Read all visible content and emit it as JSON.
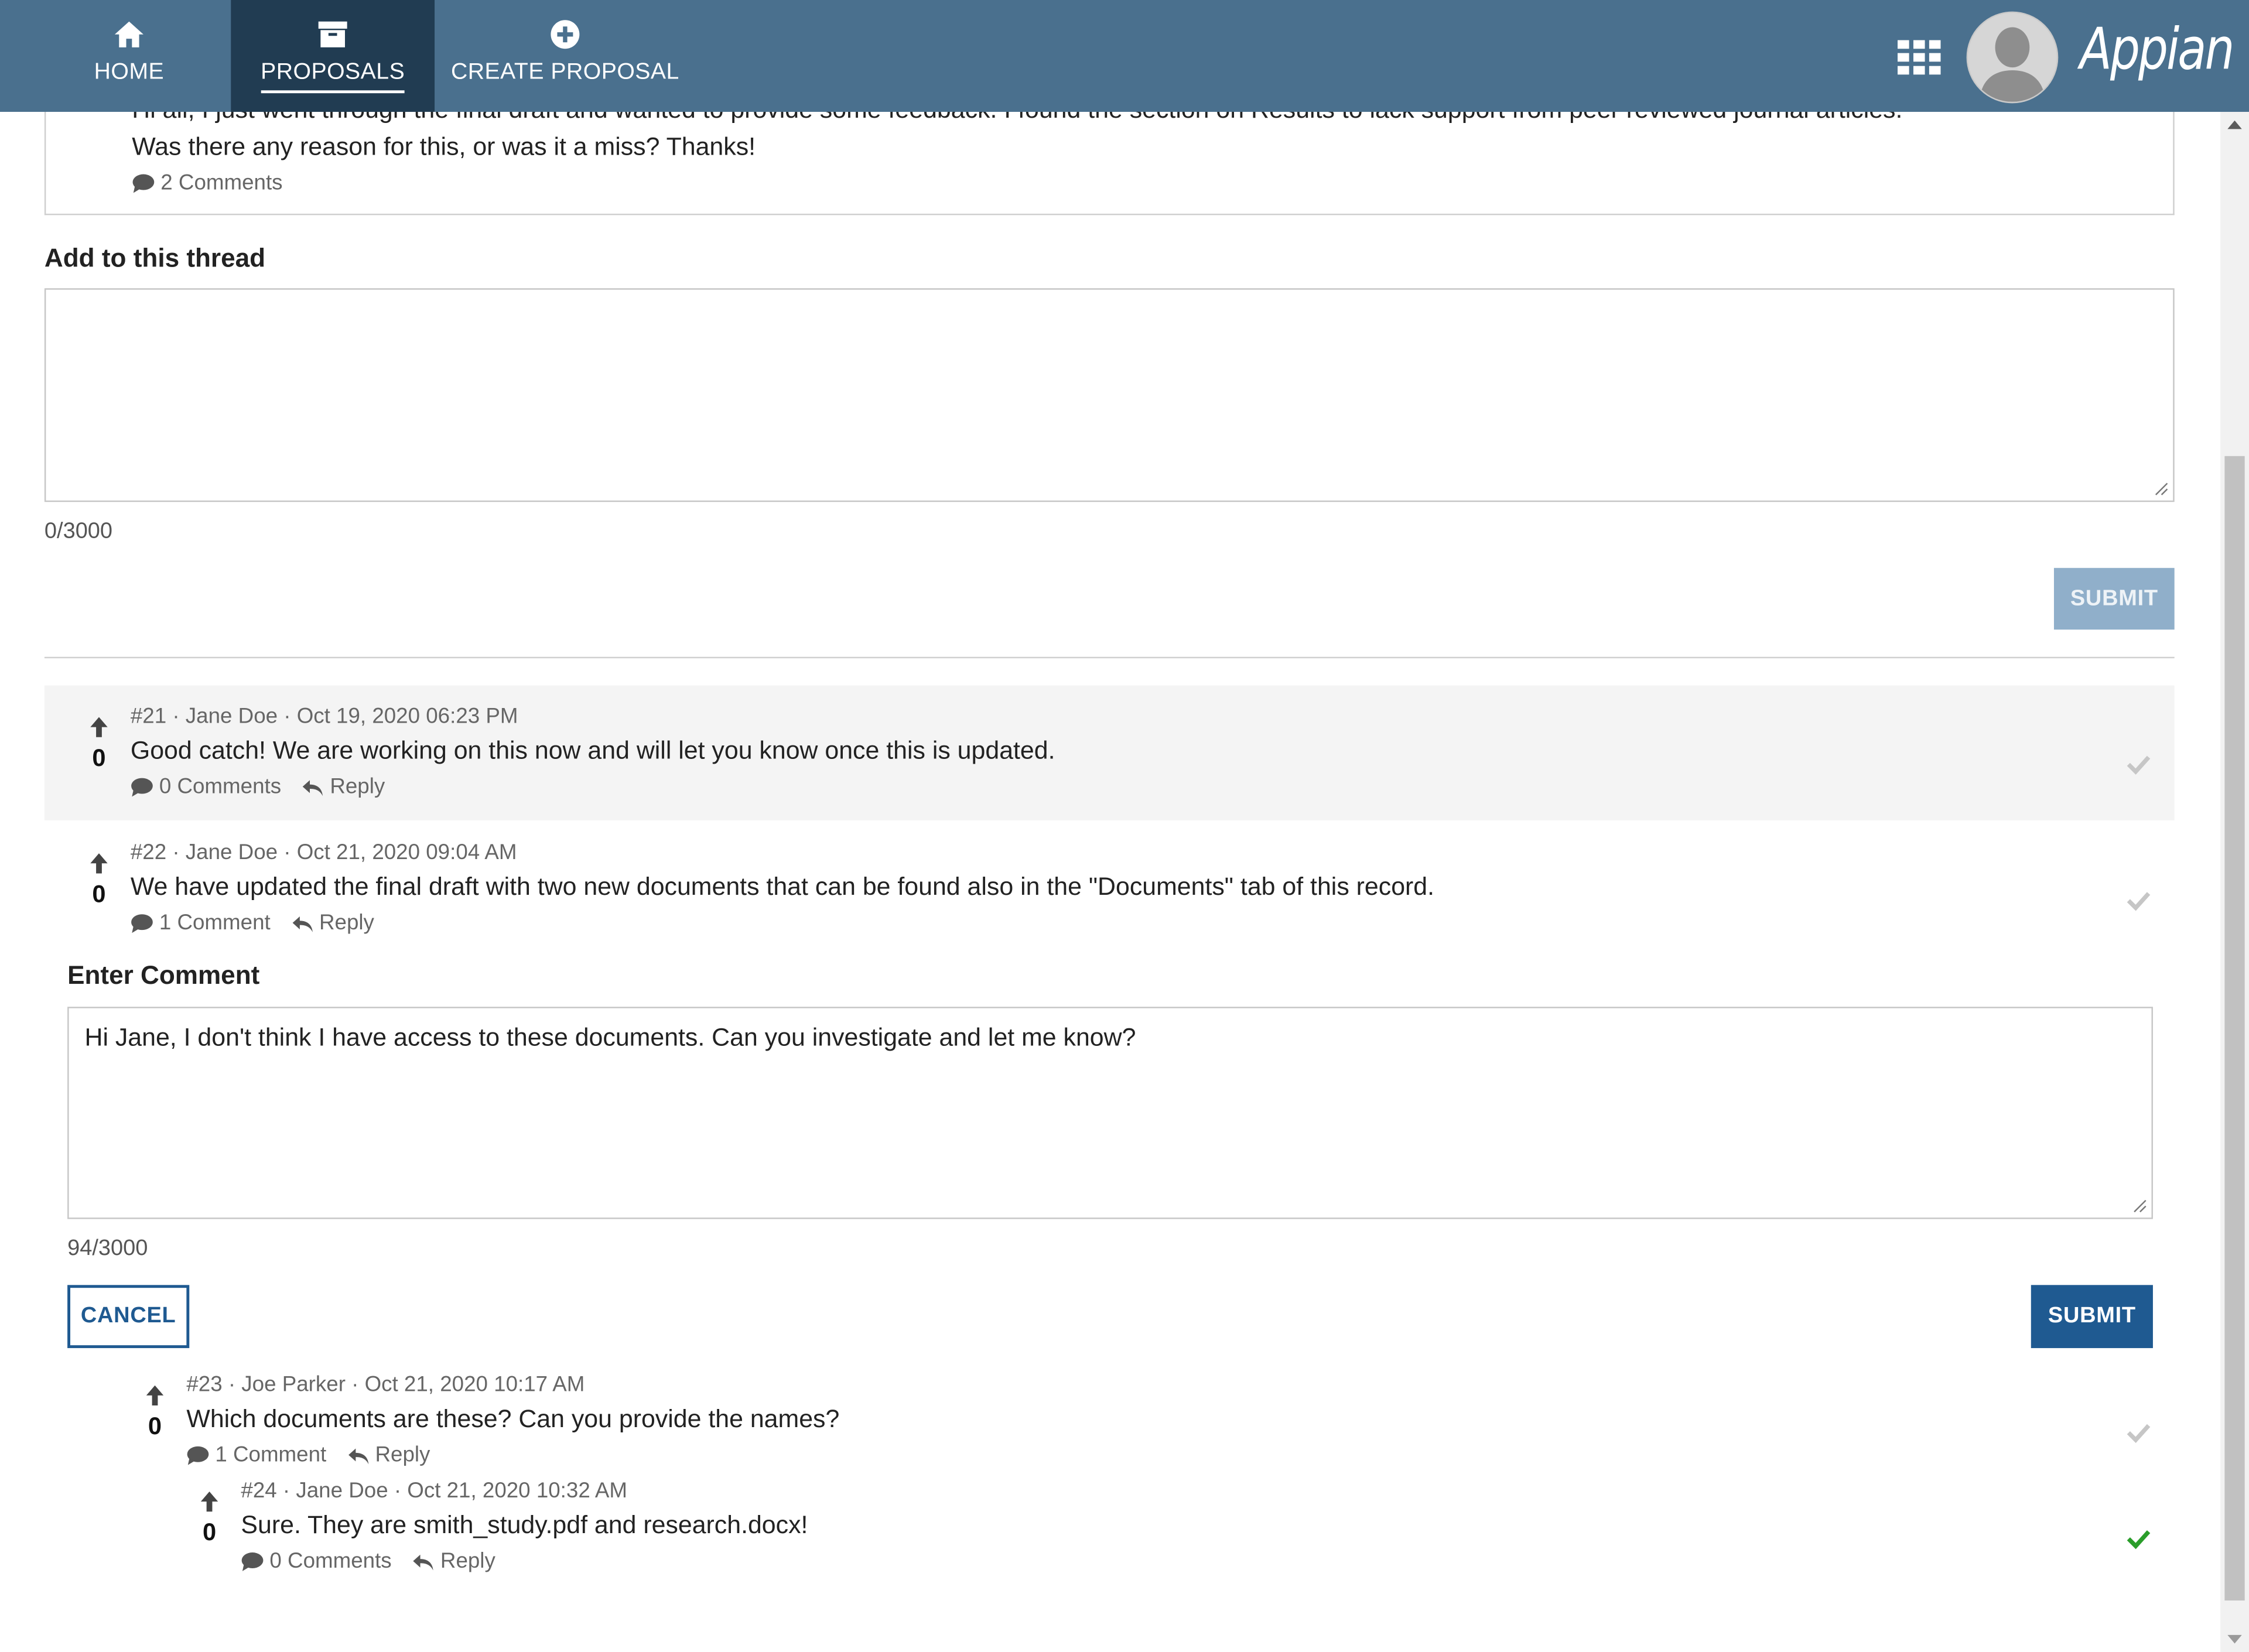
{
  "nav": {
    "items": [
      {
        "label": "HOME",
        "icon": "home-icon"
      },
      {
        "label": "PROPOSALS",
        "icon": "archive-box-icon"
      },
      {
        "label": "CREATE PROPOSAL",
        "icon": "plus-circle-icon"
      }
    ],
    "apps_icon": "grid-icon",
    "brand": "Appian"
  },
  "top_post": {
    "line1": "Hi all, I just went through the final draft and wanted to provide some feedback.  I found the section on Results to lack support from peer reviewed journal articles.",
    "line2": "Was there any reason for this, or was it a miss?  Thanks!",
    "comments_label": "2 Comments"
  },
  "thread_form": {
    "label": "Add to this thread",
    "value": "",
    "counter": "0/3000",
    "submit_label": "SUBMIT"
  },
  "comments": [
    {
      "meta": "#21 · Jane Doe · Oct 19, 2020 06:23 PM",
      "score": "0",
      "body": "Good catch!  We are working on this now and will let you know once this is updated.",
      "comments_label": "0 Comments",
      "reply_label": "Reply",
      "accepted": false
    },
    {
      "meta": "#22 · Jane Doe · Oct 21, 2020 09:04 AM",
      "score": "0",
      "body": "We have updated the final draft with two new documents that can be found also in the \"Documents\" tab of this record.",
      "comments_label": "1 Comment",
      "reply_label": "Reply",
      "accepted": false
    },
    {
      "meta": "#23 · Joe Parker · Oct 21, 2020 10:17 AM",
      "score": "0",
      "body": "Which documents are these?  Can you provide the names?",
      "comments_label": "1 Comment",
      "reply_label": "Reply",
      "accepted": false
    },
    {
      "meta": "#24 · Jane Doe · Oct 21, 2020 10:32 AM",
      "score": "0",
      "body": "Sure.  They are smith_study.pdf and research.docx!",
      "comments_label": "0 Comments",
      "reply_label": "Reply",
      "accepted": true
    }
  ],
  "comment_form": {
    "label": "Enter Comment",
    "value": "Hi Jane, I don't think I have access to these documents.  Can you investigate and let me know?",
    "counter": "94/3000",
    "cancel_label": "CANCEL",
    "submit_label": "SUBMIT"
  },
  "colors": {
    "nav_bg": "#4a708e",
    "nav_active": "#213c52",
    "primary": "#1f5a91",
    "disabled": "#90afca",
    "accepted_check": "#2a9d2a"
  }
}
